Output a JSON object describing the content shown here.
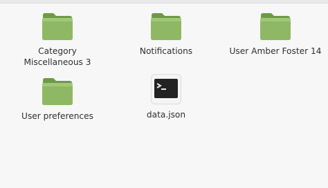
{
  "files": [
    {
      "name": "Category\nMiscellaneous 3",
      "line1": "Category",
      "line2": "Miscellaneous 3",
      "type": "folder",
      "icon": "folder-icon"
    },
    {
      "name": "Notifications",
      "line1": "Notifications",
      "type": "folder",
      "icon": "folder-icon"
    },
    {
      "name": "User Amber Foster 14",
      "line1": "User Amber Foster 14",
      "type": "folder",
      "icon": "folder-icon"
    },
    {
      "name": "User preferences",
      "line1": "User preferences",
      "type": "folder",
      "icon": "folder-icon"
    },
    {
      "name": "data.json",
      "line1": "data.json",
      "type": "file",
      "icon": "terminal-file-icon"
    }
  ],
  "colors": {
    "background": "#f7f7f7",
    "folder_green": "#8fb865",
    "folder_green_dark": "#6e9a45",
    "text": "#2f2f2f"
  }
}
